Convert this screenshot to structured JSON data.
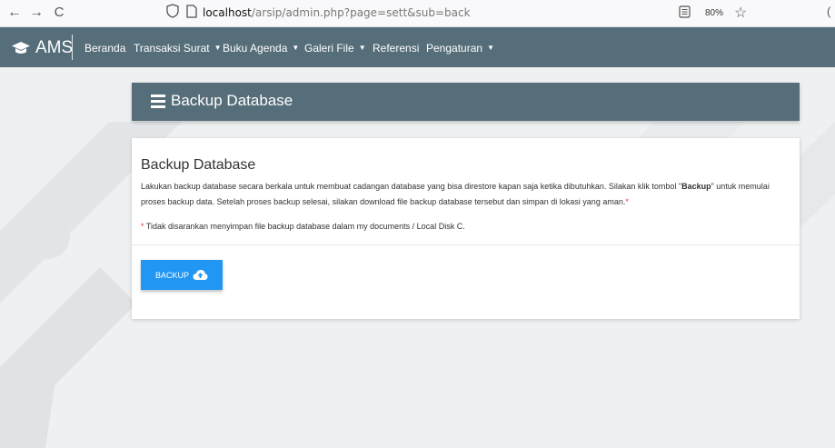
{
  "browser": {
    "back": "←",
    "forward": "→",
    "reload": "C",
    "url_host": "localhost",
    "url_path": "/arsip/admin.php?page=sett&sub=back",
    "zoom": "80%",
    "edge_glyph": "("
  },
  "navbar": {
    "brand": "AMS",
    "items": [
      {
        "label": "Beranda",
        "dropdown": false
      },
      {
        "label": "Transaksi Surat",
        "dropdown": true
      },
      {
        "label": "Buku Agenda",
        "dropdown": true
      },
      {
        "label": "Galeri File",
        "dropdown": true
      },
      {
        "label": "Referensi",
        "dropdown": false
      },
      {
        "label": "Pengaturan",
        "dropdown": true
      }
    ],
    "caret": "▼"
  },
  "header": {
    "title": "Backup Database"
  },
  "card": {
    "title": "Backup Database",
    "desc_part1": "Lakukan backup database secara berkala untuk membuat cadangan database yang bisa direstore kapan saja ketika dibutuhkan. Silakan klik tombol \"",
    "desc_bold": "Backup",
    "desc_part2": "\" untuk memulai proses backup data. Setelah proses backup selesai, silakan download file backup database tersebut dan simpan di lokasi yang aman.",
    "asterisk": "*",
    "note": " Tidak disarankan menyimpan file backup database dalam my documents / Local Disk C.",
    "button_label": "BACKUP"
  },
  "colors": {
    "navbar": "#556e79",
    "button": "#2196f3",
    "asterisk": "#e53935"
  },
  "icons": {
    "brand": "graduation-cap-icon",
    "header": "list-icon",
    "button": "cloud-upload-icon"
  }
}
